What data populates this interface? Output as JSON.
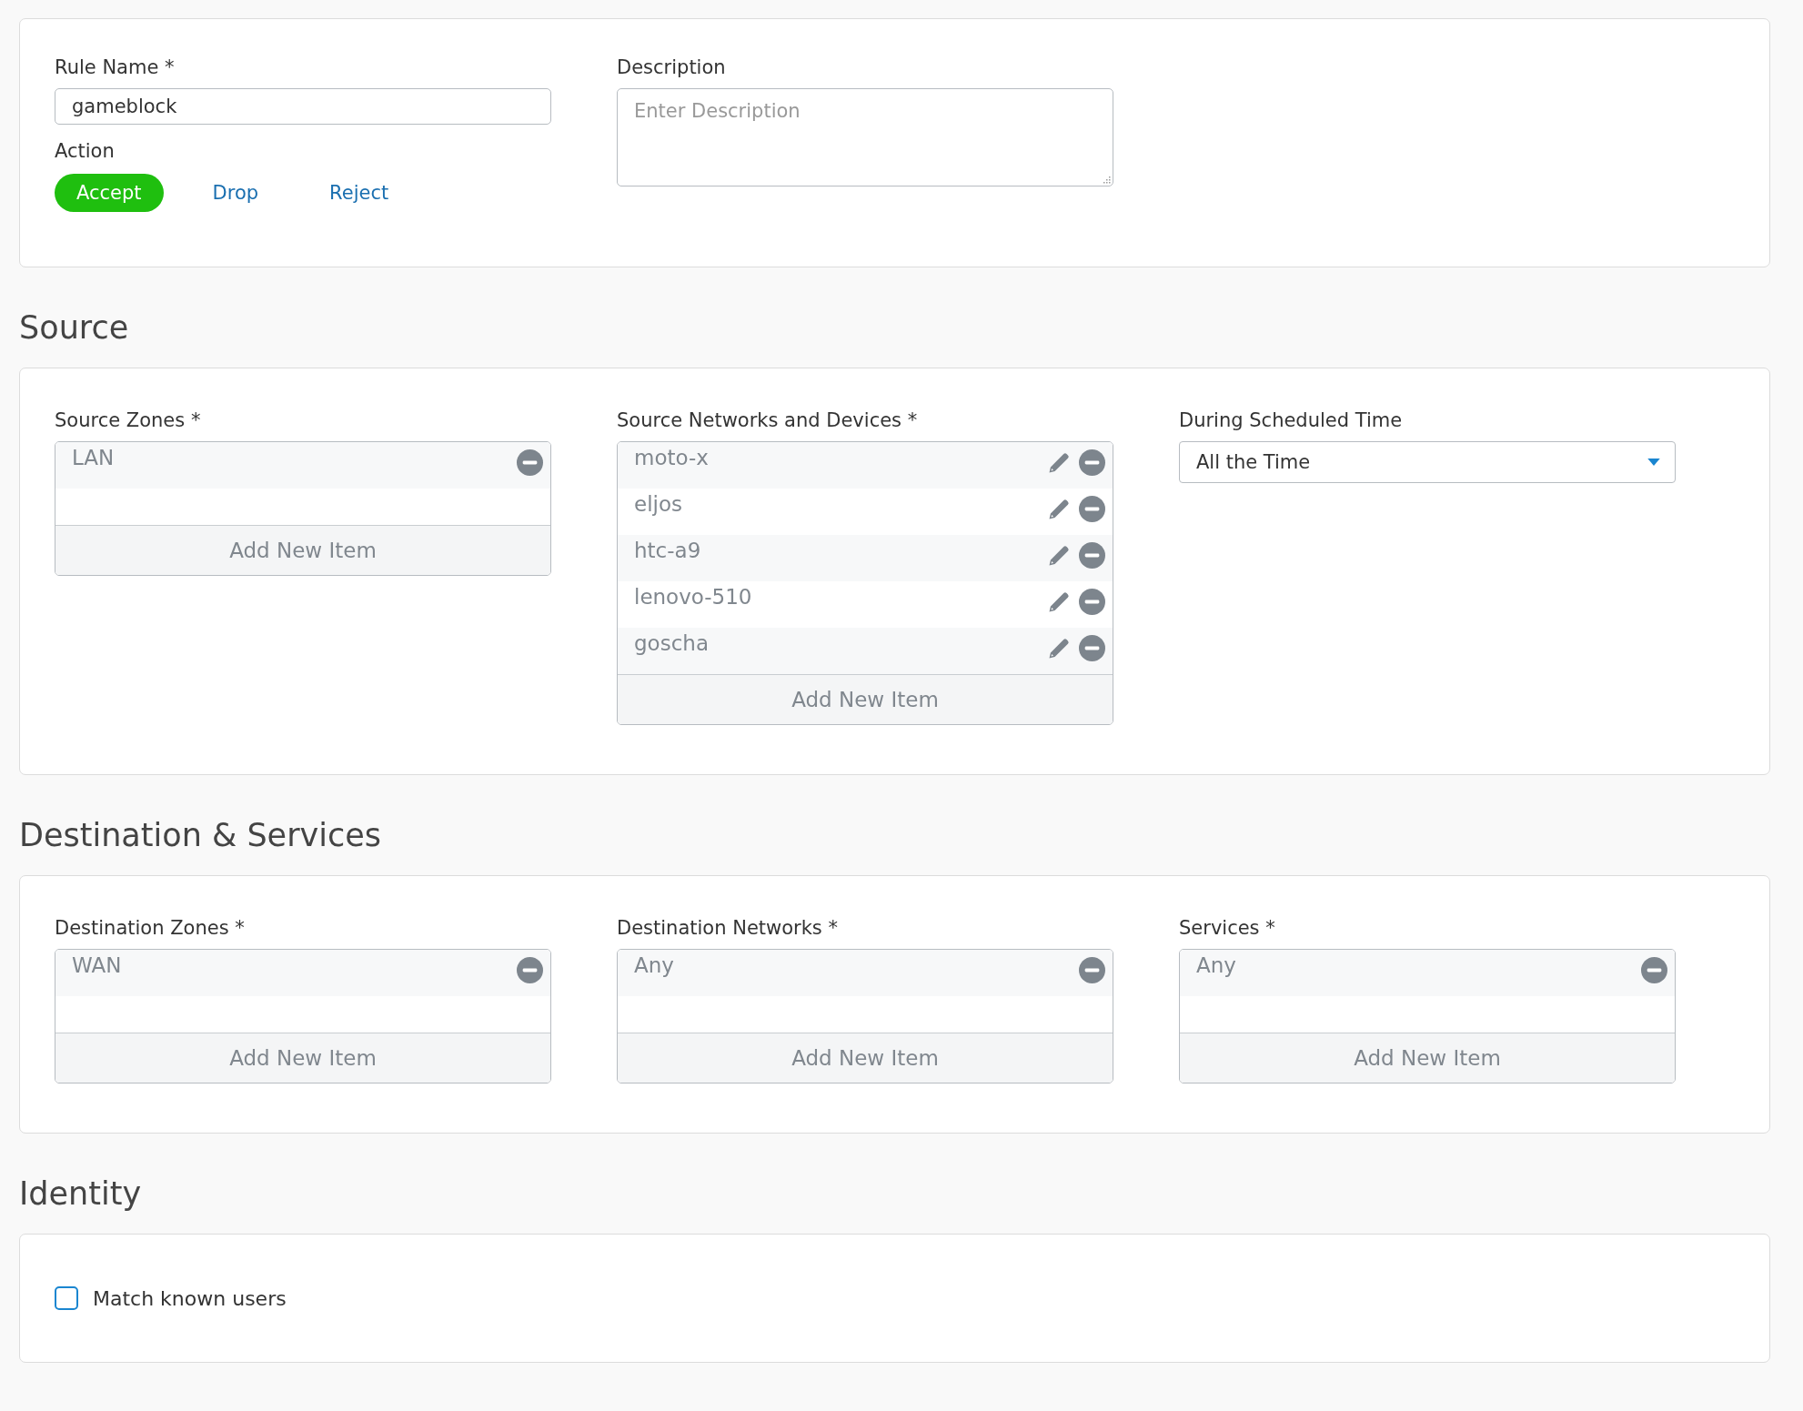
{
  "rule": {
    "name_label": "Rule Name *",
    "name_value": "gameblock",
    "action_label": "Action",
    "actions": [
      {
        "label": "Accept",
        "selected": true
      },
      {
        "label": "Drop",
        "selected": false
      },
      {
        "label": "Reject",
        "selected": false
      }
    ],
    "description_label": "Description",
    "description_placeholder": "Enter Description"
  },
  "sections": [
    {
      "heading": "Source",
      "fields": [
        {
          "kind": "list",
          "label": "Source Zones *",
          "items": [
            {
              "name": "LAN",
              "editable": false
            }
          ],
          "add_label": "Add New Item"
        },
        {
          "kind": "list",
          "label": "Source Networks and Devices *",
          "items": [
            {
              "name": "moto-x",
              "editable": true
            },
            {
              "name": "eljos",
              "editable": true
            },
            {
              "name": "htc-a9",
              "editable": true
            },
            {
              "name": "lenovo-510",
              "editable": true
            },
            {
              "name": "goscha",
              "editable": true
            }
          ],
          "add_label": "Add New Item"
        },
        {
          "kind": "select",
          "label": "During Scheduled Time",
          "value": "All the Time"
        }
      ]
    },
    {
      "heading": "Destination & Services",
      "fields": [
        {
          "kind": "list",
          "label": "Destination Zones *",
          "items": [
            {
              "name": "WAN",
              "editable": false
            }
          ],
          "add_label": "Add New Item"
        },
        {
          "kind": "list",
          "label": "Destination Networks *",
          "items": [
            {
              "name": "Any",
              "editable": false
            }
          ],
          "add_label": "Add New Item"
        },
        {
          "kind": "list",
          "label": "Services *",
          "items": [
            {
              "name": "Any",
              "editable": false
            }
          ],
          "add_label": "Add New Item"
        }
      ]
    }
  ],
  "identity": {
    "heading": "Identity",
    "match_known_users": {
      "label": "Match known users",
      "checked": false
    }
  }
}
